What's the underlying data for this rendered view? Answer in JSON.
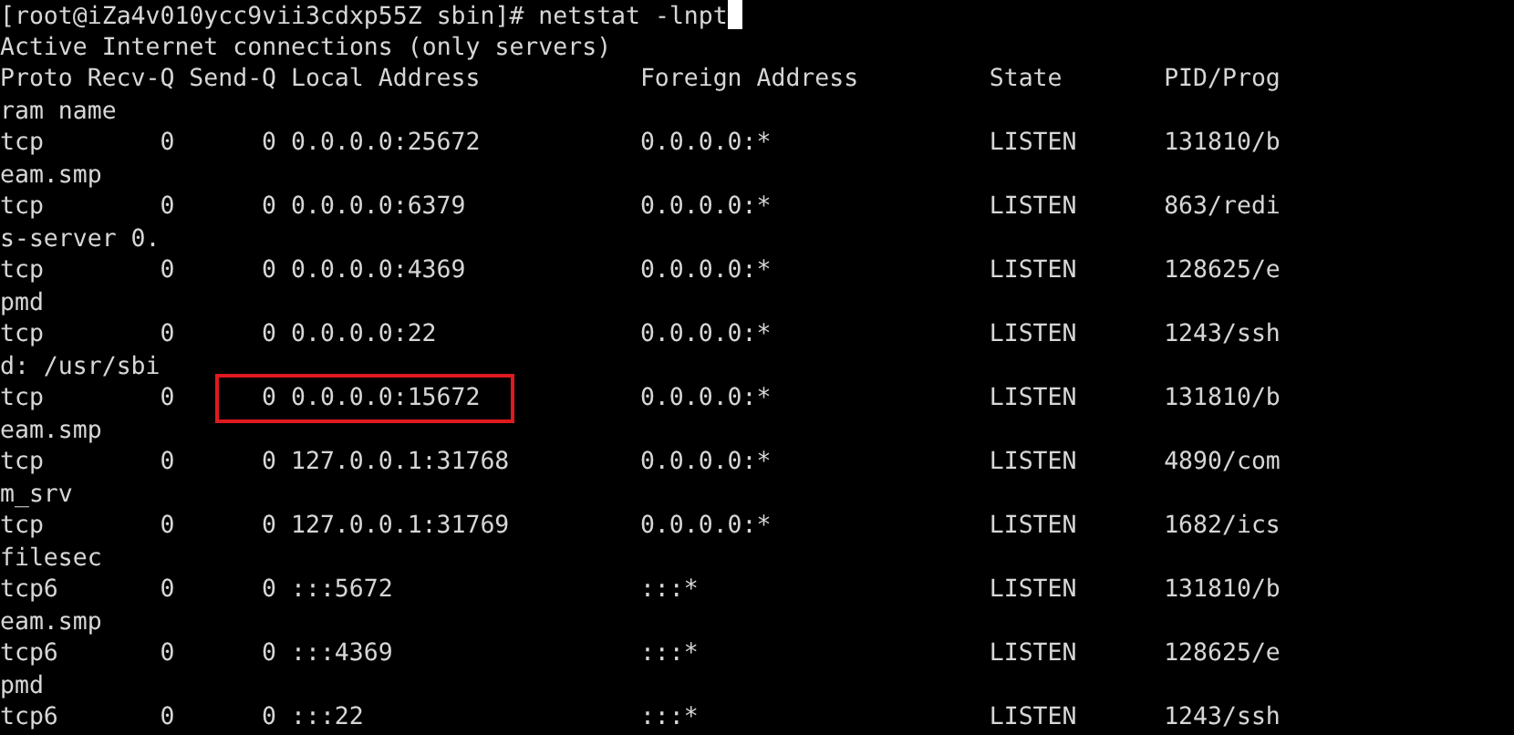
{
  "terminal": {
    "command_line": "[root@iZa4v010ycc9vii3cdxp55Z sbin]# netstat -lnpt",
    "output_title": "Active Internet connections (only servers)",
    "columns": [
      "Proto",
      "Recv-Q",
      "Send-Q",
      "Local Address",
      "Foreign Address",
      "State",
      "PID/Prog"
    ],
    "columns_wrapped": "ram name",
    "rows": [
      {
        "proto": "tcp",
        "recv_q": "0",
        "send_q": "0",
        "local_address": "0.0.0.0:25672",
        "foreign_address": "0.0.0.0:*",
        "state": "LISTEN",
        "pid_program": "131810/b",
        "wrapped": "eam.smp",
        "highlighted": false
      },
      {
        "proto": "tcp",
        "recv_q": "0",
        "send_q": "0",
        "local_address": "0.0.0.0:6379",
        "foreign_address": "0.0.0.0:*",
        "state": "LISTEN",
        "pid_program": "863/redi",
        "wrapped": "s-server 0.",
        "highlighted": false
      },
      {
        "proto": "tcp",
        "recv_q": "0",
        "send_q": "0",
        "local_address": "0.0.0.0:4369",
        "foreign_address": "0.0.0.0:*",
        "state": "LISTEN",
        "pid_program": "128625/e",
        "wrapped": "pmd",
        "highlighted": false
      },
      {
        "proto": "tcp",
        "recv_q": "0",
        "send_q": "0",
        "local_address": "0.0.0.0:22",
        "foreign_address": "0.0.0.0:*",
        "state": "LISTEN",
        "pid_program": "1243/ssh",
        "wrapped": "d: /usr/sbi",
        "highlighted": false
      },
      {
        "proto": "tcp",
        "recv_q": "0",
        "send_q": "0",
        "local_address": "0.0.0.0:15672",
        "foreign_address": "0.0.0.0:*",
        "state": "LISTEN",
        "pid_program": "131810/b",
        "wrapped": "eam.smp",
        "highlighted": true
      },
      {
        "proto": "tcp",
        "recv_q": "0",
        "send_q": "0",
        "local_address": "127.0.0.1:31768",
        "foreign_address": "0.0.0.0:*",
        "state": "LISTEN",
        "pid_program": "4890/com",
        "wrapped": "m_srv",
        "highlighted": false
      },
      {
        "proto": "tcp",
        "recv_q": "0",
        "send_q": "0",
        "local_address": "127.0.0.1:31769",
        "foreign_address": "0.0.0.0:*",
        "state": "LISTEN",
        "pid_program": "1682/ics",
        "wrapped": "filesec",
        "highlighted": false
      },
      {
        "proto": "tcp6",
        "recv_q": "0",
        "send_q": "0",
        "local_address": ":::5672",
        "foreign_address": ":::*",
        "state": "LISTEN",
        "pid_program": "131810/b",
        "wrapped": "eam.smp",
        "highlighted": false
      },
      {
        "proto": "tcp6",
        "recv_q": "0",
        "send_q": "0",
        "local_address": ":::4369",
        "foreign_address": ":::*",
        "state": "LISTEN",
        "pid_program": "128625/e",
        "wrapped": "pmd",
        "highlighted": false
      },
      {
        "proto": "tcp6",
        "recv_q": "0",
        "send_q": "0",
        "local_address": ":::22",
        "foreign_address": ":::*",
        "state": "LISTEN",
        "pid_program": "1243/ssh",
        "highlighted": false
      }
    ]
  }
}
